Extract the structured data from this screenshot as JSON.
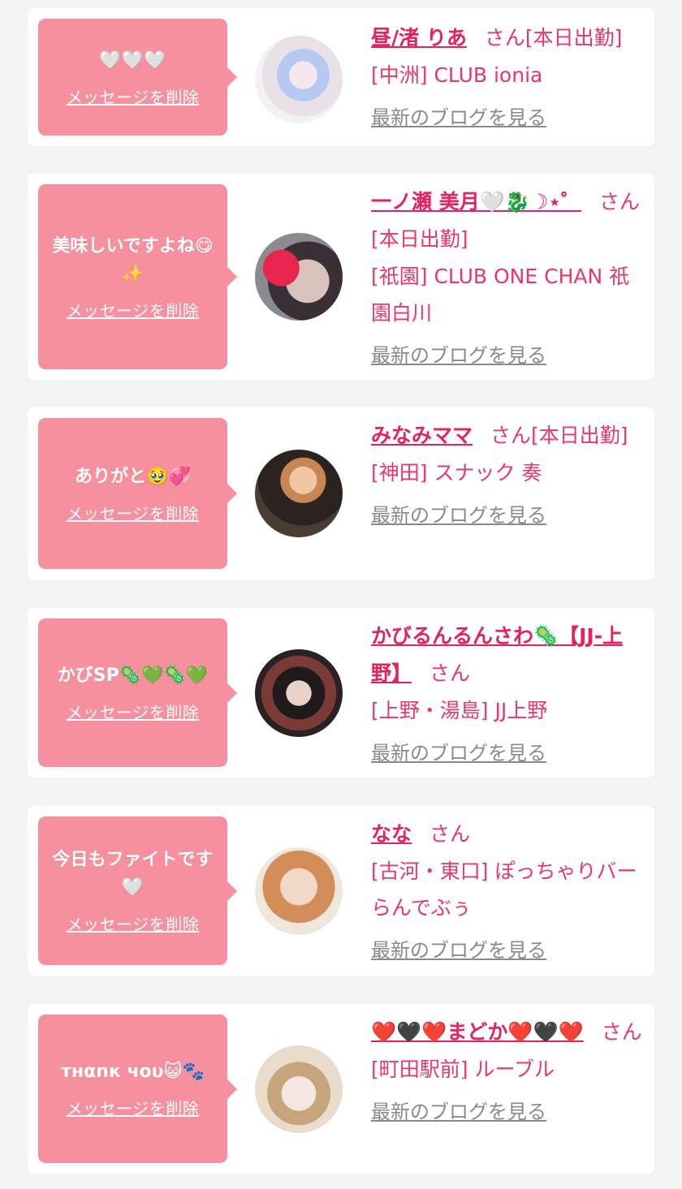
{
  "delete_label": "メッセージを削除",
  "blog_label": "最新のブログを見る",
  "san_label": "さん",
  "colors": {
    "bubble": "#f7909e",
    "name": "#e4235e",
    "shop": "#e8386a",
    "link": "#8a8a8a"
  },
  "cards": [
    {
      "message": "🤍🤍🤍",
      "cast_name": "昼/渚 りあ",
      "status": "[本日出勤]",
      "shop": "[中洲] CLUB ionia",
      "avatar": "cast-photo-1"
    },
    {
      "message": "美味しいですよね😋✨",
      "cast_name": "一ノ瀬 美月🤍🐉☽⋆゜",
      "status": "[本日出勤]",
      "shop": "[祇園] CLUB ONE CHAN 祇園白川",
      "avatar": "cast-photo-2"
    },
    {
      "message": "ありがと🥹💞",
      "cast_name": "みなみママ",
      "status": "[本日出勤]",
      "shop": "[神田] スナック 奏",
      "avatar": "cast-photo-3"
    },
    {
      "message": "かびSP🦠💚🦠💚",
      "cast_name": "かびるんるんさわ🦠【JJ-上野】",
      "status": "",
      "shop": "[上野・湯島] JJ上野",
      "avatar": "cast-photo-4"
    },
    {
      "message": "今日もファイトです🤍",
      "cast_name": "なな",
      "status": "",
      "shop": "[古河・東口] ぽっちゃりバー らんでぶぅ",
      "avatar": "cast-photo-5"
    },
    {
      "message": "тнαnк чου😺🐾",
      "cast_name": "❤️🖤❤️まどか❤️🖤❤️",
      "status": "",
      "shop": "[町田駅前] ルーブル",
      "avatar": "cast-photo-6"
    }
  ]
}
